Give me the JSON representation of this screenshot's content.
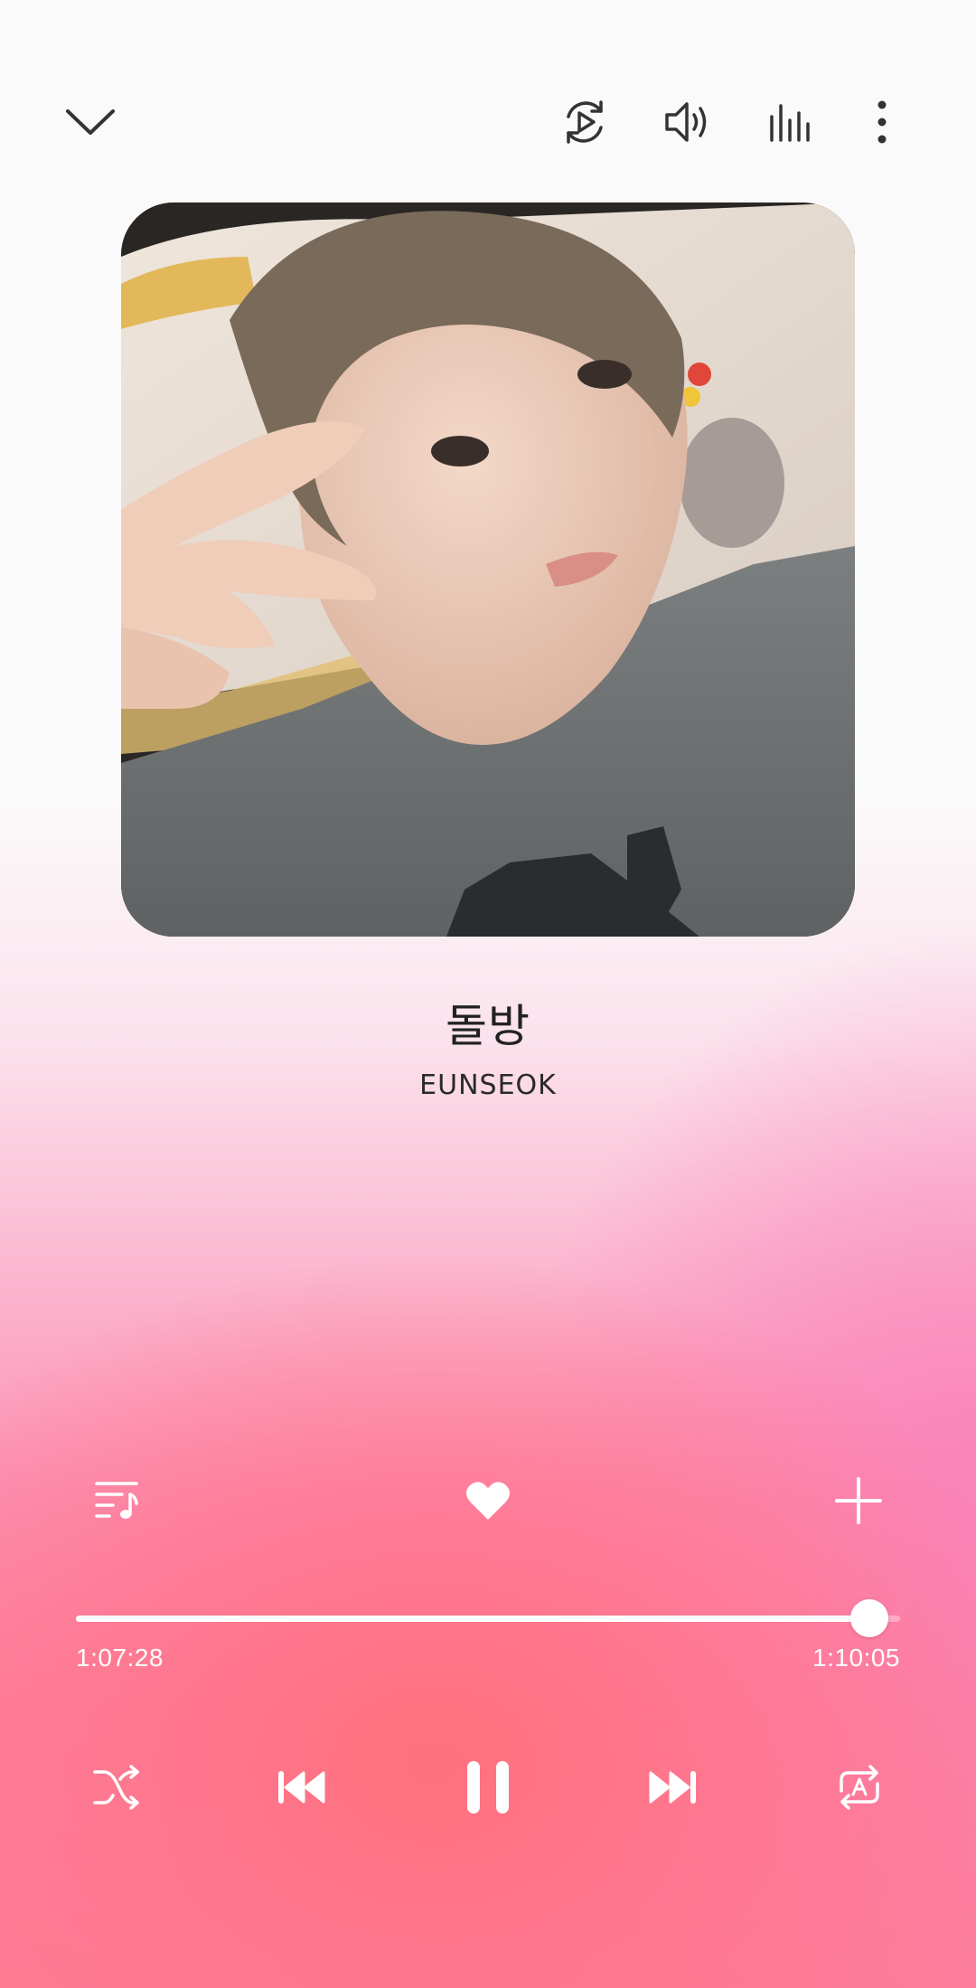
{
  "header": {
    "collapse_icon": "chevron-down-icon",
    "autoplay_icon": "play-circle-repeat-icon",
    "volume_icon": "speaker-icon",
    "equalizer_icon": "equalizer-icon",
    "more_icon": "more-vertical-icon"
  },
  "track": {
    "title": "돌방",
    "artist": "EUNSEOK"
  },
  "actions": {
    "queue_icon": "queue-music-icon",
    "favorite_icon": "heart-icon",
    "add_icon": "plus-icon"
  },
  "progress": {
    "elapsed": "1:07:28",
    "total": "1:10:05",
    "fraction": 0.963
  },
  "controls": {
    "shuffle_icon": "shuffle-icon",
    "previous_icon": "skip-previous-icon",
    "pause_icon": "pause-icon",
    "next_icon": "skip-next-icon",
    "repeat_icon": "repeat-a-icon"
  },
  "colors": {
    "accent": "#ffffff",
    "gradient_bottom": "#fc7c93",
    "gradient_pink": "#fc90b4"
  }
}
